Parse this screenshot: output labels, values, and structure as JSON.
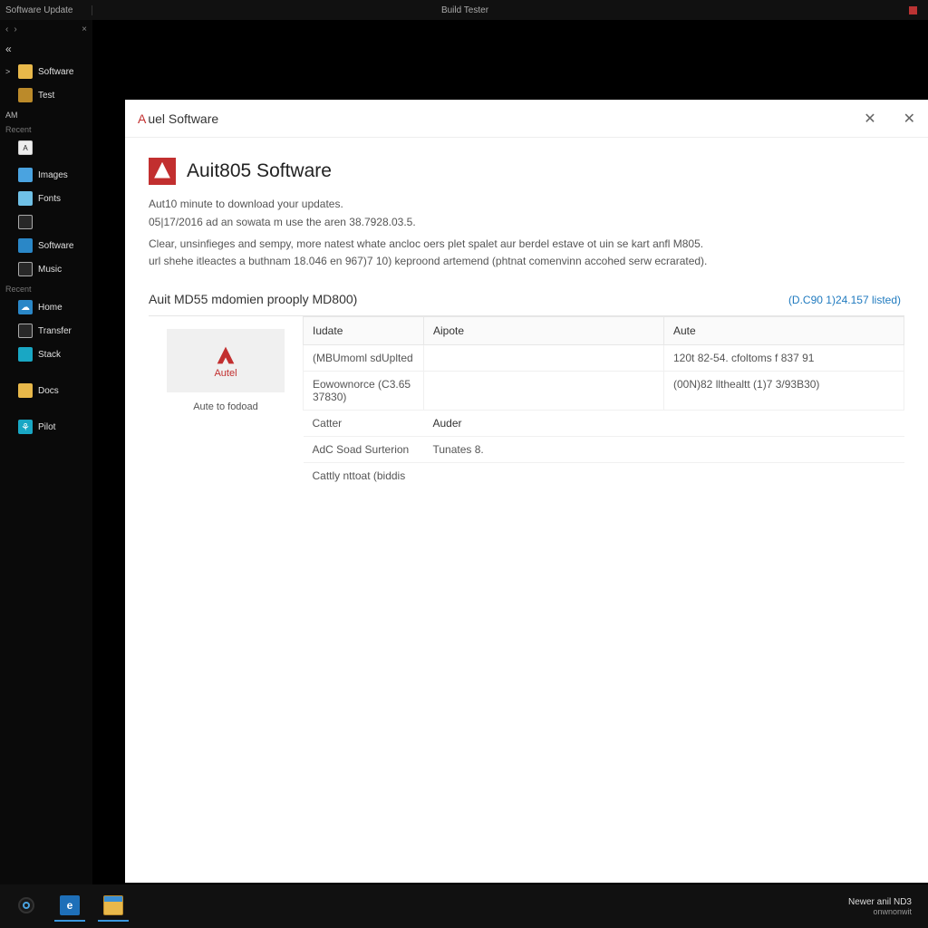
{
  "titlebar": {
    "left": "Software Update",
    "center": "Build Tester"
  },
  "sidebar": {
    "chev": "«",
    "items": [
      {
        "icon": "ico-folder",
        "label": "Software",
        "arrow": ">"
      },
      {
        "icon": "ico-folder-dk",
        "label": "Test"
      }
    ],
    "group1_label": "AM",
    "group1_sub": "Recent",
    "group1": [
      {
        "icon": "ico-white",
        "label": ""
      },
      {
        "icon": "ico-img",
        "label": "Images"
      },
      {
        "icon": "ico-lightblue",
        "label": "Fonts"
      },
      {
        "icon": "ico-box",
        "label": ""
      },
      {
        "icon": "ico-blue2",
        "label": "Software"
      },
      {
        "icon": "ico-box",
        "label": "Music"
      }
    ],
    "group2_label": "Recent",
    "group2": [
      {
        "icon": "ico-cloud",
        "label": "Home"
      },
      {
        "icon": "ico-box",
        "label": "Transfer"
      },
      {
        "icon": "ico-cyan",
        "label": "Stack"
      },
      {
        "icon": "",
        "label": ""
      },
      {
        "icon": "ico-folder",
        "label": "Docs"
      },
      {
        "icon": "",
        "label": ""
      },
      {
        "icon": "ico-people",
        "label": "Pilot"
      }
    ]
  },
  "panel": {
    "brand_a": "A",
    "title_rest": "uel Software",
    "heading": "Auit805 Software",
    "sub1": "Aut10 minute to download your updates.",
    "sub2": "05|17/2016 ad an sowata m use the aren 38.7928.03.5.",
    "desc1": "Clear, unsinfieges and sempy, more natest whate ancloc oers plet spalet aur berdel estave ot uin se kart anfl M805.",
    "desc2": "url shehe itleactes a buthnam 18.046 en 967)7 10) keproond artemend (phtnat comenvinn accohed serw ecrarated).",
    "section_title": "Auit MD55 mdomien prooply MD800)",
    "section_link": "(D.C90 1)24.157 listed)",
    "thumb_logo_label": "Autel",
    "thumb_caption": "Aute to fodoad",
    "table": {
      "headers": [
        "Iudate",
        "Aipote",
        "Aute"
      ],
      "rows": [
        [
          "(MBUmoml sdUplted",
          "",
          "120t 82-54. cfoltoms f 837 91"
        ],
        [
          "Eowownorce (C3.65 37830)",
          "",
          "(00N)82 llthealtt (1)7 3/93B30)"
        ]
      ],
      "footer_col1": [
        "Catter",
        "AdC Soad Surterion",
        "Cattly nttoat (biddis"
      ],
      "footer_col2_hdr": "Auder",
      "footer_col2": [
        "Tunates 8."
      ]
    }
  },
  "taskbar": {
    "status1": "Newer anil ND3",
    "status2": "onwnonwit"
  }
}
